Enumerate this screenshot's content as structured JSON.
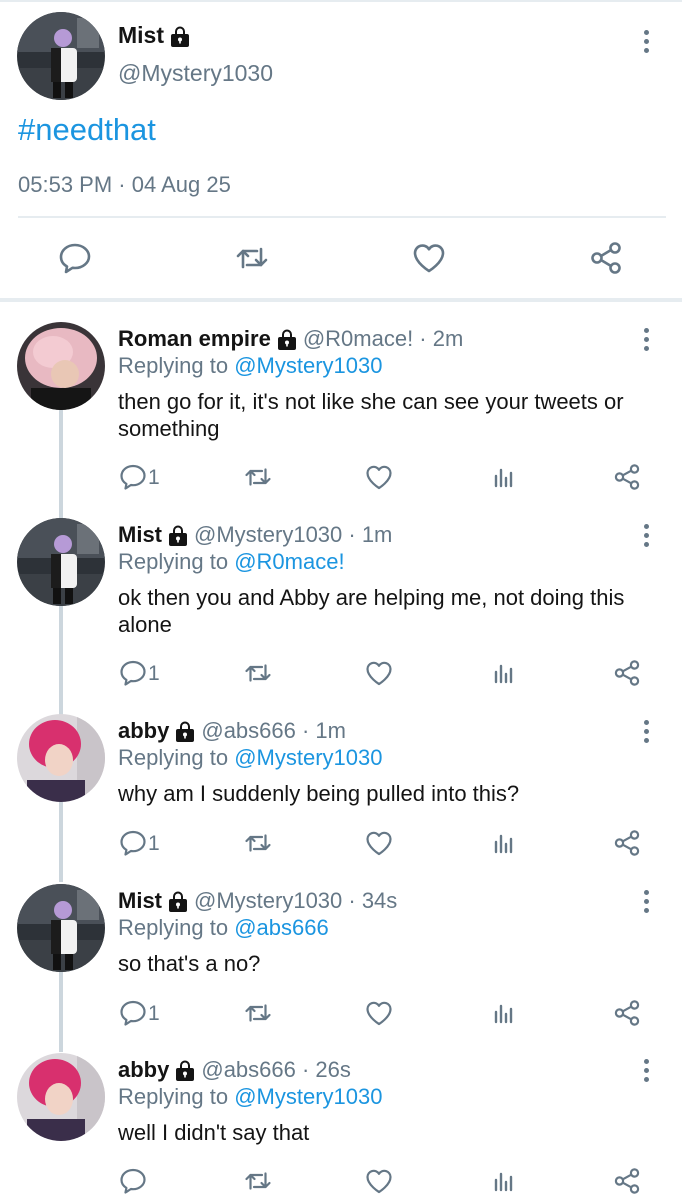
{
  "main_tweet": {
    "name": "Mist",
    "handle": "@Mystery1030",
    "text": "#needthat",
    "timestamp": "05:53 PM · 04 Aug 25",
    "avatar": "avatar-mist",
    "actions": [
      "reply-icon",
      "retweet-icon",
      "like-icon",
      "share-icon"
    ]
  },
  "replies": [
    {
      "name": "Roman empire",
      "handle_time": "@R0mace! · 2m",
      "replying_prefix": "Replying to",
      "replying_to": "@Mystery1030",
      "text": "then go for it, it's not like she can see your tweets or something",
      "reply_count": "1",
      "avatar": "avatar-pink-hair"
    },
    {
      "name": "Mist",
      "handle_time": "@Mystery1030 · 1m",
      "replying_prefix": "Replying to",
      "replying_to": "@R0mace!",
      "text": "ok then you and Abby are helping me, not doing this alone",
      "reply_count": "1",
      "avatar": "avatar-mist"
    },
    {
      "name": "abby",
      "handle_time": "@abs666 · 1m",
      "replying_prefix": "Replying to",
      "replying_to": "@Mystery1030",
      "text": "why am I suddenly being pulled into this?",
      "reply_count": "1",
      "avatar": "avatar-abby"
    },
    {
      "name": "Mist",
      "handle_time": "@Mystery1030 · 34s",
      "replying_prefix": "Replying to",
      "replying_to": "@abs666",
      "text": "so that's a no?",
      "reply_count": "1",
      "avatar": "avatar-mist"
    },
    {
      "name": "abby",
      "handle_time": "@abs666 · 26s",
      "replying_prefix": "Replying to",
      "replying_to": "@Mystery1030",
      "text": "well I didn't say that",
      "reply_count": "",
      "avatar": "avatar-abby"
    }
  ],
  "colors": {
    "link": "#1b95e0",
    "muted": "#657786",
    "divider": "#e6ecf0",
    "thread_line": "#ccd6dd"
  },
  "icons": {
    "lock": "lock-icon",
    "more": "more-vertical-icon",
    "reply": "reply-icon",
    "retweet": "retweet-icon",
    "like": "like-icon",
    "analytics": "analytics-icon",
    "share": "share-icon"
  }
}
